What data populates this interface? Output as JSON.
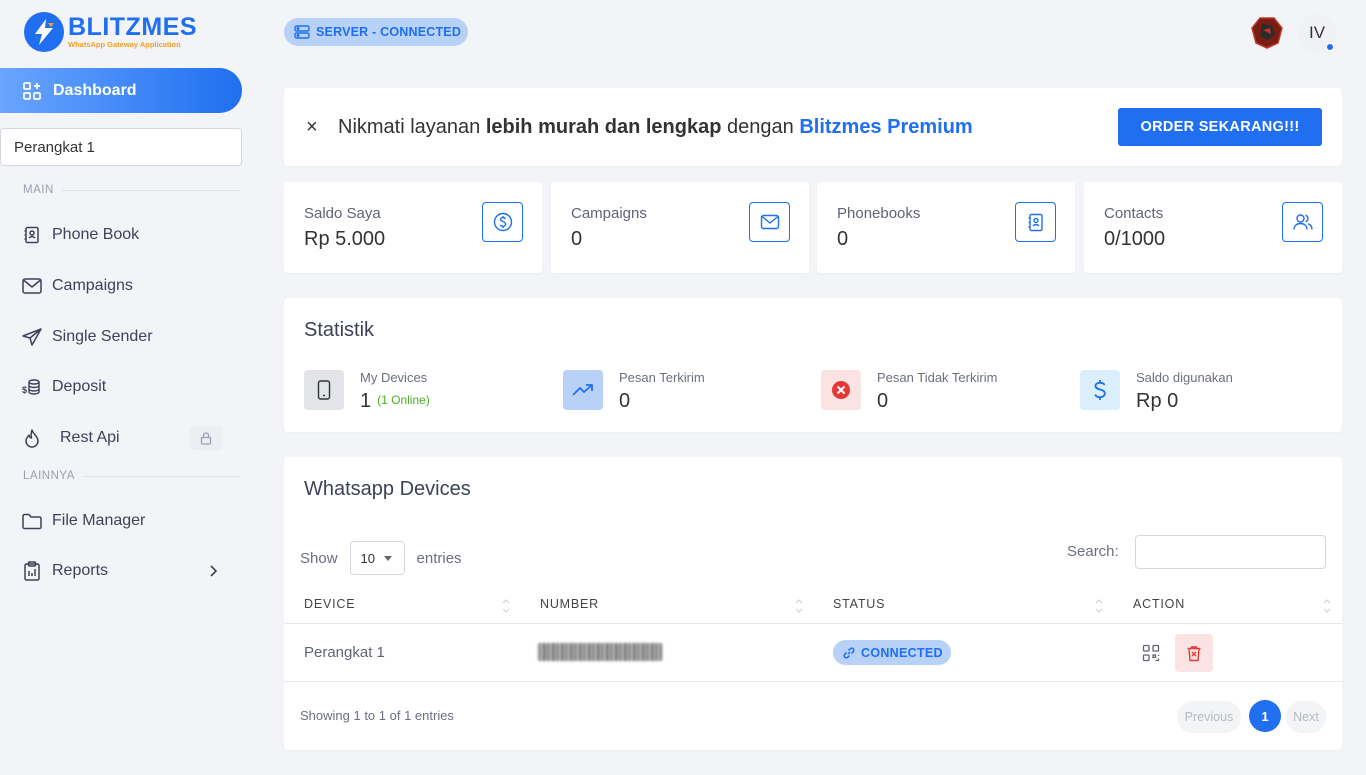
{
  "brand": {
    "name": "BLITZMES",
    "tagline": "WhatsApp Gateway Application",
    "color": "#1f6ff0",
    "accent": "#f0a020"
  },
  "sidebar": {
    "active_item": {
      "label": "Dashboard",
      "icon": "dashboard-icon"
    },
    "device_select": "Perangkat 1",
    "sections": {
      "main": "MAIN",
      "other": "LAINNYA"
    },
    "items": [
      {
        "label": "Phone Book",
        "icon": "phonebook-icon"
      },
      {
        "label": "Campaigns",
        "icon": "mail-icon"
      },
      {
        "label": "Single Sender",
        "icon": "send-icon"
      },
      {
        "label": "Deposit",
        "icon": "coins-icon"
      },
      {
        "label": "Rest Api",
        "icon": "fire-icon",
        "locked": true
      },
      {
        "label": "File Manager",
        "icon": "folder-icon"
      },
      {
        "label": "Reports",
        "icon": "clipboard-icon",
        "has_submenu": true
      }
    ]
  },
  "topbar": {
    "server_status": "SERVER - CONNECTED",
    "user_initials": "IV"
  },
  "banner": {
    "close": "×",
    "text_1": "Nikmati layanan ",
    "text_bold": "lebih murah dan lengkap",
    "text_2": " dengan ",
    "text_premium": "Blitzmes Premium",
    "cta": "ORDER SEKARANG!!!"
  },
  "stats": [
    {
      "label": "Saldo Saya",
      "value": "Rp 5.000",
      "icon": "dollar-circle-icon"
    },
    {
      "label": "Campaigns",
      "value": "0",
      "icon": "mail-icon"
    },
    {
      "label": "Phonebooks",
      "value": "0",
      "icon": "phonebook-icon"
    },
    {
      "label": "Contacts",
      "value": "0/1000",
      "icon": "users-icon"
    }
  ],
  "statistik": {
    "title": "Statistik",
    "items": [
      {
        "label": "My Devices",
        "value": "1",
        "extra": "(1 Online)",
        "icon": "phone-icon"
      },
      {
        "label": "Pesan Terkirim",
        "value": "0",
        "icon": "trend-up-icon"
      },
      {
        "label": "Pesan Tidak Terkirim",
        "value": "0",
        "icon": "x-circle-icon"
      },
      {
        "label": "Saldo digunakan",
        "value": "Rp 0",
        "icon": "dollar-icon"
      }
    ]
  },
  "devices": {
    "title": "Whatsapp Devices",
    "show_label": "Show",
    "page_length": "10",
    "entries_label": "entries",
    "search_label": "Search:",
    "columns": [
      "DEVICE",
      "NUMBER",
      "STATUS",
      "ACTION"
    ],
    "rows": [
      {
        "device": "Perangkat 1",
        "status": "CONNECTED"
      }
    ],
    "info": "Showing 1 to 1 of 1 entries",
    "pagination": {
      "prev": "Previous",
      "current": "1",
      "next": "Next"
    }
  }
}
